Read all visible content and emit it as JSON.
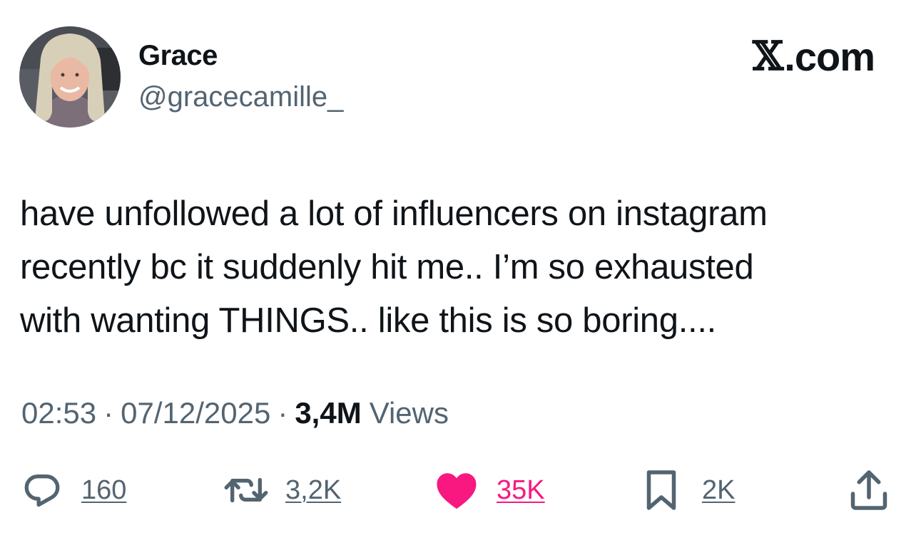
{
  "author": {
    "name": "Grace",
    "handle": "@gracecamille_"
  },
  "brand": {
    "x_glyph": "𝕏",
    "suffix": ".com"
  },
  "tweet": {
    "lines": [
      "have unfollowed a lot of influencers on instagram",
      "recently bc it suddenly hit me.. I’m so exhausted",
      "with wanting THINGS.. like this is so boring...."
    ]
  },
  "meta": {
    "time": "02:53",
    "separator": "·",
    "date": "07/12/2025",
    "views_count": "3,4M",
    "views_label": "Views"
  },
  "actions": {
    "replies": "160",
    "reposts": "3,2K",
    "likes": "35K",
    "bookmarks": "2K"
  },
  "colors": {
    "text": "#0f1419",
    "secondary": "#536471",
    "like": "#f91880"
  },
  "icons": [
    "reply-icon",
    "repost-icon",
    "heart-icon",
    "bookmark-icon",
    "share-icon"
  ]
}
